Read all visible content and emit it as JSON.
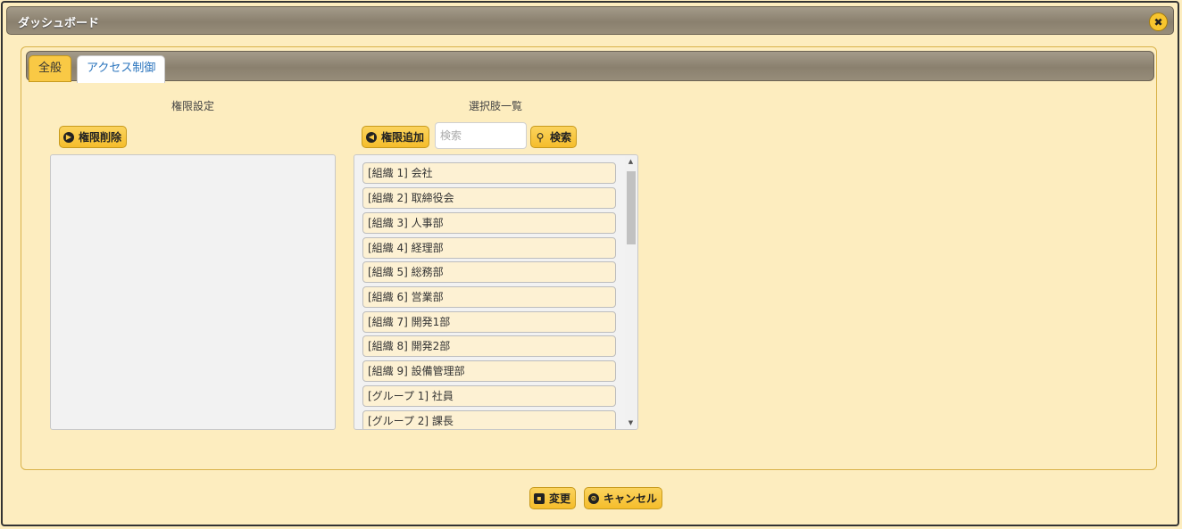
{
  "window": {
    "title": "ダッシュボード"
  },
  "tabs": [
    {
      "label": "全般",
      "active": false
    },
    {
      "label": "アクセス制御",
      "active": true
    }
  ],
  "left_section": {
    "title": "権限設定",
    "remove_button": "権限削除",
    "items": []
  },
  "right_section": {
    "title": "選択肢一覧",
    "add_button": "権限追加",
    "search_placeholder": "検索",
    "search_value": "",
    "search_button": "検索",
    "items": [
      "[組織 1] 会社",
      "[組織 2] 取締役会",
      "[組織 3] 人事部",
      "[組織 4] 経理部",
      "[組織 5] 総務部",
      "[組織 6] 営業部",
      "[組織 7] 開発1部",
      "[組織 8] 開発2部",
      "[組織 9] 設備管理部",
      "[グループ 1] 社員",
      "[グループ 2] 課長"
    ]
  },
  "footer": {
    "change_button": "変更",
    "cancel_button": "キャンセル"
  },
  "icons": {
    "close": "close-icon",
    "remove": "circle-right-arrow-icon",
    "add": "circle-left-arrow-icon",
    "search": "magnifier-icon",
    "save": "save-icon",
    "cancel": "cancel-icon"
  },
  "colors": {
    "background": "#fdedbf",
    "accent_yellow": "#f9c945",
    "titlebar": "#8a806e",
    "active_tab_text": "#2a74bd"
  }
}
